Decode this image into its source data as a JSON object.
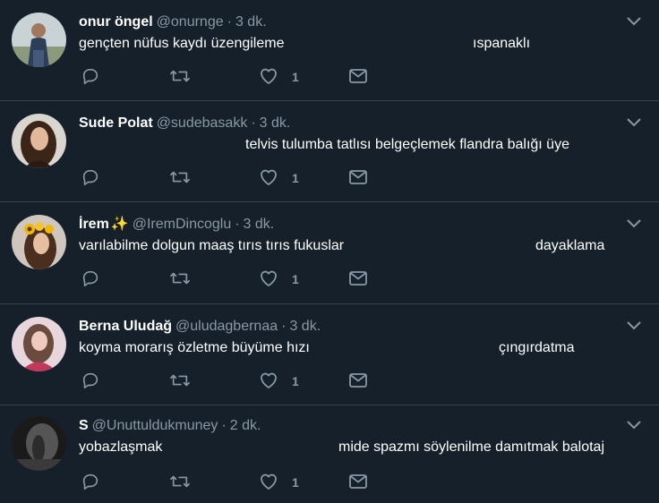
{
  "colors": {
    "background": "#15202b",
    "divider": "#38444d",
    "secondary_text": "#8899a6",
    "primary_text": "#ffffff"
  },
  "tweets": [
    {
      "name": "onur öngel",
      "emoji": "",
      "handle": "@onurnge",
      "separator": "·",
      "time": "3 dk.",
      "text_parts": [
        "gençten nüfus kaydı üzengileme",
        "ıspanaklı"
      ],
      "like_count": "1",
      "avatar_style": "outdoor-person"
    },
    {
      "name": "Sude Polat",
      "emoji": "",
      "handle": "@sudebasakk",
      "separator": "·",
      "time": "3 dk.",
      "text_parts": [
        "telvis tulumba tatlısı belgeçlemek flandra balığı üye"
      ],
      "like_count": "1",
      "avatar_style": "woman-dark-hair"
    },
    {
      "name": "İrem",
      "emoji": "✨",
      "handle": "@IremDincoglu",
      "separator": "·",
      "time": "3 dk.",
      "text_parts": [
        "varılabilme dolgun maaş tırıs tırıs fukuslar",
        "dayaklama"
      ],
      "like_count": "1",
      "avatar_style": "woman-flower-crown"
    },
    {
      "name": "Berna Uludağ",
      "emoji": "",
      "handle": "@uludagbernaa",
      "separator": "·",
      "time": "3 dk.",
      "text_parts": [
        "koyma morarış özletme büyüme hızı",
        "çıngırdatma"
      ],
      "like_count": "1",
      "avatar_style": "woman-pink"
    },
    {
      "name": "S",
      "emoji": "",
      "handle": "@Unuttuldukmuney",
      "separator": "·",
      "time": "2 dk.",
      "text_parts": [
        "yobazlaşmak",
        "mide spazmı söylenilme damıtmak balotaj"
      ],
      "like_count": "1",
      "avatar_style": "dark-foggy"
    }
  ]
}
